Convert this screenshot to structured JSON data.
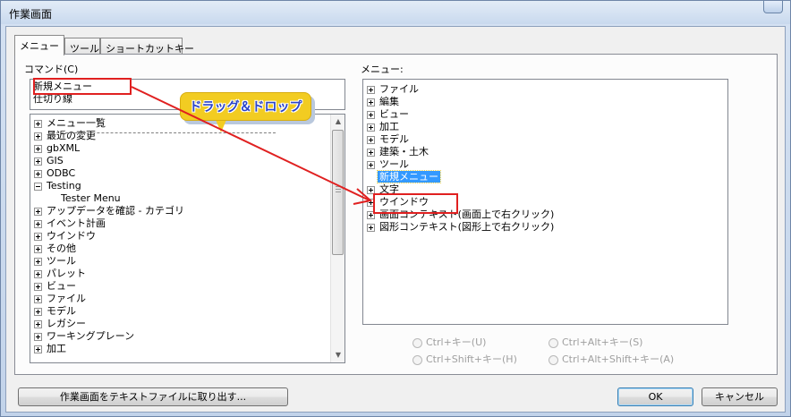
{
  "window": {
    "title": "作業画面"
  },
  "tabs": [
    {
      "label": "メニュー"
    },
    {
      "label": "ツール"
    },
    {
      "label": "ショートカットキー"
    }
  ],
  "commands": {
    "label": "コマンド(C)",
    "items": [
      "新規メニュー",
      "仕切り線"
    ]
  },
  "callout": {
    "text": "ドラッグ＆ドロップ"
  },
  "command_tree": {
    "items": [
      {
        "label": "メニュー一覧",
        "toggle": "plus"
      },
      {
        "label": "最近の変更",
        "toggle": "plus"
      },
      {
        "label": "gbXML",
        "toggle": "plus"
      },
      {
        "label": "GIS",
        "toggle": "plus"
      },
      {
        "label": "ODBC",
        "toggle": "plus"
      },
      {
        "label": "Testing",
        "toggle": "minus"
      },
      {
        "label": "Tester Menu",
        "toggle": "none"
      },
      {
        "label": "アップデータを確認 - カテゴリ",
        "toggle": "plus"
      },
      {
        "label": "イベント計画",
        "toggle": "plus"
      },
      {
        "label": "ウインドウ",
        "toggle": "plus"
      },
      {
        "label": "その他",
        "toggle": "plus"
      },
      {
        "label": "ツール",
        "toggle": "plus"
      },
      {
        "label": "パレット",
        "toggle": "plus"
      },
      {
        "label": "ビュー",
        "toggle": "plus"
      },
      {
        "label": "ファイル",
        "toggle": "plus"
      },
      {
        "label": "モデル",
        "toggle": "plus"
      },
      {
        "label": "レガシー",
        "toggle": "plus"
      },
      {
        "label": "ワーキングプレーン",
        "toggle": "plus"
      },
      {
        "label": "加工",
        "toggle": "plus"
      }
    ]
  },
  "menu_tree": {
    "label": "メニュー:",
    "items": [
      {
        "label": "ファイル",
        "toggle": "plus"
      },
      {
        "label": "編集",
        "toggle": "plus"
      },
      {
        "label": "ビュー",
        "toggle": "plus"
      },
      {
        "label": "加工",
        "toggle": "plus"
      },
      {
        "label": "モデル",
        "toggle": "plus"
      },
      {
        "label": "建築・土木",
        "toggle": "plus"
      },
      {
        "label": "ツール",
        "toggle": "plus"
      },
      {
        "label": "新規メニュー",
        "toggle": "none",
        "selected": true
      },
      {
        "label": "文字",
        "toggle": "plus"
      },
      {
        "label": "ウインドウ",
        "toggle": "plus"
      },
      {
        "label": "画面コンテキスト(画面上で右クリック)",
        "toggle": "plus"
      },
      {
        "label": "図形コンテキスト(図形上で右クリック)",
        "toggle": "plus"
      }
    ]
  },
  "shortcut_options": [
    {
      "label": "Ctrl+キー(U)"
    },
    {
      "label": "Ctrl+Alt+キー(S)"
    },
    {
      "label": "Ctrl+Shift+キー(H)"
    },
    {
      "label": "Ctrl+Alt+Shift+キー(A)"
    }
  ],
  "buttons": {
    "export": "作業画面をテキストファイルに取り出す...",
    "ok": "OK",
    "cancel": "キャンセル"
  },
  "colors": {
    "annotation_red": "#e02020",
    "callout_fill": "#f2cc22",
    "callout_text": "#2a43c8",
    "selection": "#3399ff"
  }
}
